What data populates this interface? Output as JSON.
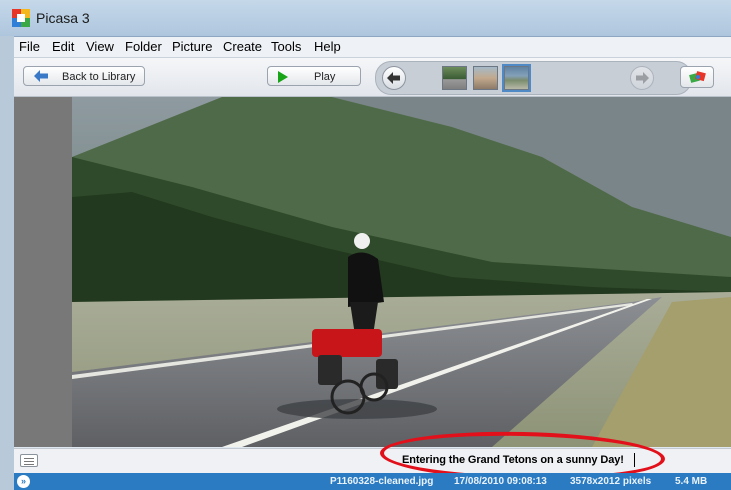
{
  "window": {
    "title": "Picasa 3"
  },
  "menu": [
    "File",
    "Edit",
    "View",
    "Folder",
    "Picture",
    "Create",
    "Tools",
    "Help"
  ],
  "toolbar": {
    "back_label": "Back to Library",
    "play_label": "Play"
  },
  "filmstrip": {
    "thumbnails": [
      "cyclist thumbnail",
      "mountain road thumbnail",
      "mountain view thumbnail"
    ],
    "selected_index": 2
  },
  "caption": {
    "text": "Entering the Grand Tetons on a sunny Day!"
  },
  "status": {
    "filename": "P1160328-cleaned.jpg",
    "date": "17/08/2010 09:08:13",
    "dimensions": "3578x2012 pixels",
    "size": "5.4 MB"
  },
  "colors": {
    "annotation": "#e2101a",
    "statusbar": "#2b7bc2",
    "play_icon": "#17a417"
  },
  "icons": {
    "back": "arrow-left-icon",
    "play": "play-icon",
    "previous": "previous-arrow-icon",
    "next": "next-arrow-icon",
    "share": "share-icon",
    "caption": "caption-icon",
    "expand": "expand-icon"
  }
}
